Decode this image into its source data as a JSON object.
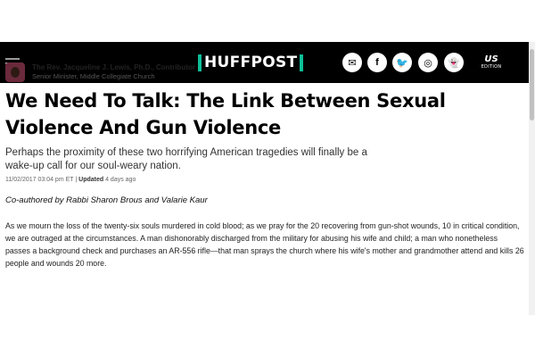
{
  "header": {
    "logo_text": "HUFFPOST",
    "edition_main": "US",
    "edition_sub": "EDITION",
    "social": [
      {
        "icon": "email-icon",
        "glyph": "✉"
      },
      {
        "icon": "facebook-icon",
        "glyph": "f"
      },
      {
        "icon": "twitter-icon",
        "glyph": "🐦"
      },
      {
        "icon": "instagram-icon",
        "glyph": "◎"
      },
      {
        "icon": "snapchat-icon",
        "glyph": "👻"
      }
    ]
  },
  "article": {
    "author_name": "The Rev. Jacqueline J. Lewis, Ph.D., Contributor",
    "author_title": "Senior Minister, Middle Collegiate Church",
    "headline": "We Need To Talk: The Link Between Sexual Violence And Gun Violence",
    "subhead": "Perhaps the proximity of these two horrifying American tragedies will finally be a wake-up call for our soul-weary nation.",
    "date": "11/02/2017 03:04 pm ET",
    "updated_label": "Updated",
    "updated_value": "4 days ago",
    "coauthors": "Co-authored by Rabbi Sharon Brous and Valarie Kaur",
    "body": "As we mourn the loss of the twenty-six souls murdered in cold blood; as we pray for the 20 recovering from gun-shot wounds, 10 in critical condition, we are outraged at the circumstances. A man dishonorably discharged from the military for abusing his wife and child; a man who nonetheless passes a background check and purchases an AR-556 rifle—that man sprays the church where his wife's mother and grandmother attend and kills 26 people and wounds 20 more."
  },
  "colors": {
    "header_bg": "#000000",
    "brand_accent": "#0dbe98"
  }
}
